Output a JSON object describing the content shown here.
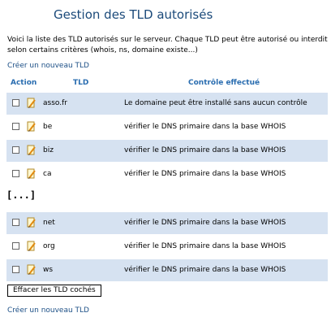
{
  "page": {
    "title": "Gestion des TLD autorisés",
    "intro": "Voici la liste des TLD autorisés sur le serveur. Chaque TLD peut être autorisé ou interdit selon certains critères (whois,  ns, domaine existe...)",
    "create_link_top": "Créer un nouveau TLD",
    "create_link_bottom": "Créer un nouveau TLD"
  },
  "table": {
    "headers": {
      "action": "Action",
      "tld": "TLD",
      "control": "Contrôle effectué"
    },
    "rows_top": [
      {
        "tld": "asso.fr",
        "control": "Le domaine peut être installé sans aucun contrôle"
      },
      {
        "tld": "be",
        "control": "vérifier le DNS primaire dans la base WHOIS"
      },
      {
        "tld": "biz",
        "control": "vérifier le DNS primaire dans la base WHOIS"
      },
      {
        "tld": "ca",
        "control": "vérifier le DNS primaire dans la base WHOIS"
      }
    ],
    "ellipsis": "[...]",
    "rows_bottom": [
      {
        "tld": "net",
        "control": "vérifier le DNS primaire dans la base WHOIS"
      },
      {
        "tld": "org",
        "control": "vérifier le DNS primaire dans la base WHOIS"
      },
      {
        "tld": "ws",
        "control": "vérifier le DNS primaire dans la base WHOIS"
      }
    ]
  },
  "actions": {
    "delete_checked": "Effacer les TLD cochés"
  },
  "icons": {
    "row_edit": "pencil-edit-icon"
  },
  "colors": {
    "title": "#1b4a7a",
    "header": "#2a6db0",
    "row_shade": "#d6e2f1",
    "link": "#1c4f86"
  }
}
